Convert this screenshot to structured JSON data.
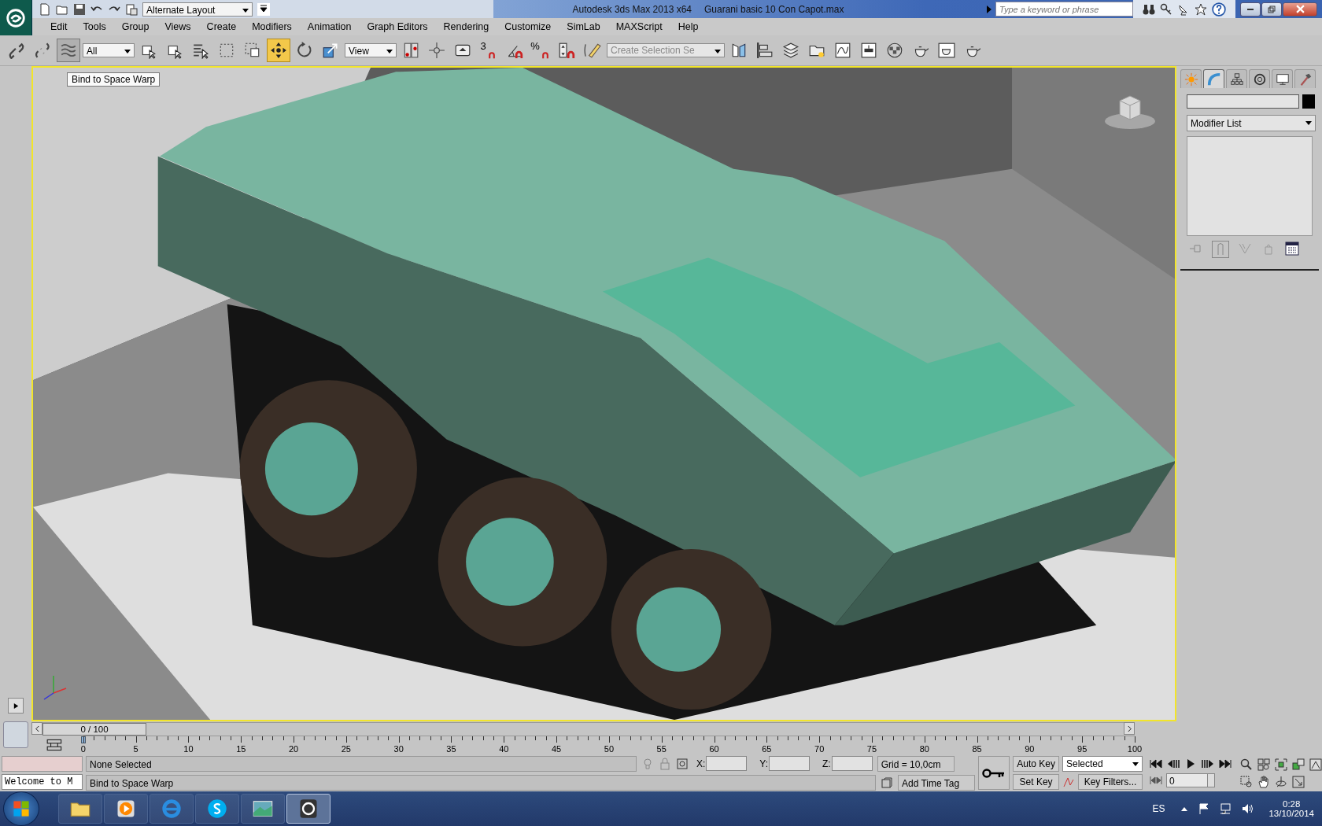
{
  "window": {
    "title": "Autodesk 3ds Max  2013 x64",
    "file": "Guarani basic 10 Con Capot.max"
  },
  "quick_access": {
    "layout": "Alternate Layout"
  },
  "search": {
    "placeholder": "Type a keyword or phrase"
  },
  "menu": [
    "Edit",
    "Tools",
    "Group",
    "Views",
    "Create",
    "Modifiers",
    "Animation",
    "Graph Editors",
    "Rendering",
    "Customize",
    "SimLab",
    "MAXScript",
    "Help"
  ],
  "main_toolbar": {
    "items": [
      {
        "kind": "tool",
        "selected": false
      },
      {
        "kind": "tool",
        "selected": false
      },
      {
        "kind": "tool",
        "selected": true
      },
      {
        "kind": "dropdown",
        "value": "All"
      },
      {
        "kind": "tool",
        "selected": false
      },
      {
        "kind": "tool",
        "selected": false
      },
      {
        "kind": "tool",
        "selected": false
      },
      {
        "kind": "tool",
        "selected": false
      },
      {
        "kind": "tool",
        "selected": false
      },
      {
        "kind": "tool",
        "selected": true
      },
      {
        "kind": "tool",
        "selected": false
      },
      {
        "kind": "tool",
        "selected": false
      },
      {
        "kind": "dropdown",
        "value": "View"
      },
      {
        "kind": "tool",
        "selected": false
      },
      {
        "kind": "tool",
        "selected": false
      },
      {
        "kind": "tool",
        "selected": false
      },
      {
        "kind": "tool",
        "selected": false,
        "glyph": "3"
      },
      {
        "kind": "tool",
        "selected": false
      },
      {
        "kind": "tool",
        "selected": false,
        "glyph": "%"
      },
      {
        "kind": "tool",
        "selected": false
      },
      {
        "kind": "tool",
        "selected": false
      },
      {
        "kind": "field",
        "placeholder": "Create Selection Se"
      },
      {
        "kind": "tool",
        "selected": false
      },
      {
        "kind": "tool",
        "selected": false
      },
      {
        "kind": "tool",
        "selected": false
      },
      {
        "kind": "tool",
        "selected": false
      },
      {
        "kind": "tool",
        "selected": false
      },
      {
        "kind": "tool",
        "selected": false
      },
      {
        "kind": "tool",
        "selected": false
      },
      {
        "kind": "tool",
        "selected": false
      },
      {
        "kind": "tool",
        "selected": false
      },
      {
        "kind": "tool",
        "selected": false
      }
    ]
  },
  "viewport": {
    "tooltip": "Bind to Space Warp"
  },
  "command_panel": {
    "tabs": [
      {
        "selected": false
      },
      {
        "selected": true
      },
      {
        "selected": false
      },
      {
        "selected": false
      },
      {
        "selected": false
      },
      {
        "selected": false
      }
    ],
    "modifier_list": "Modifier List"
  },
  "time_slider": {
    "label": "0 / 100",
    "level": 0
  },
  "track_bar": {
    "labels": [
      "0",
      "5",
      "10",
      "15",
      "20",
      "25",
      "30",
      "35",
      "40",
      "45",
      "50",
      "55",
      "60",
      "65",
      "70",
      "75",
      "80",
      "85",
      "90",
      "95",
      "100"
    ]
  },
  "listener": {
    "text": "Welcome to M"
  },
  "status": {
    "selection": "None Selected",
    "prompt": "Bind to Space Warp",
    "x_label": "X:",
    "y_label": "Y:",
    "z_label": "Z:",
    "grid": "Grid = 10,0cm",
    "time_tag": "Add Time Tag"
  },
  "animation": {
    "auto_key": "Auto Key",
    "set_key": "Set Key",
    "key_mode": "Selected",
    "key_filters": "Key Filters...",
    "frame": "0"
  },
  "taskbar": {
    "apps": [
      {
        "selected": false
      },
      {
        "selected": false
      },
      {
        "selected": false
      },
      {
        "selected": false
      },
      {
        "selected": false
      },
      {
        "selected": true
      }
    ],
    "language": "ES",
    "time": "0:28",
    "date": "13/10/2014"
  }
}
